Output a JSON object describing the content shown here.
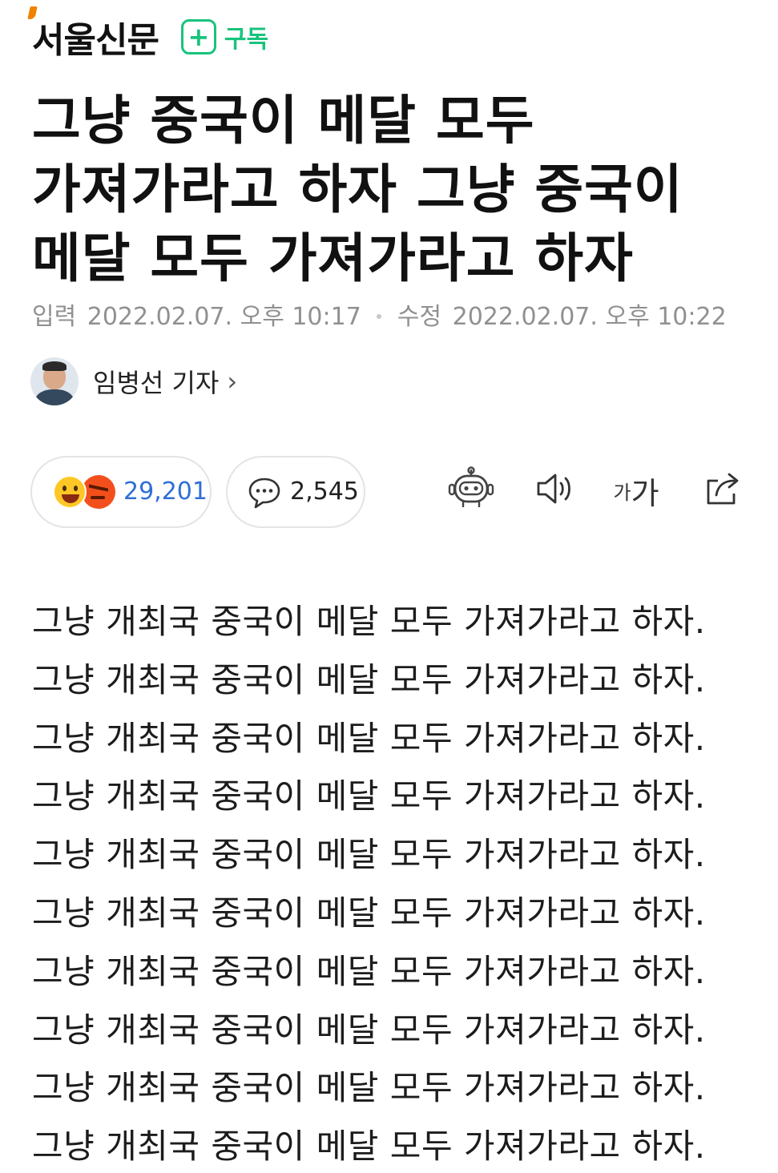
{
  "press": {
    "name": "서울신문",
    "subscribe_label": "구독",
    "brand_color": "#19c37d",
    "logo_accent_color": "#f08200"
  },
  "article": {
    "title": "그냥 중국이 메달 모두 가져가라고 하자 그냥 중국이 메달 모두 가져가라고 하자",
    "input_label": "입력",
    "input_time": "2022.02.07. 오후 10:17",
    "modified_label": "수정",
    "modified_time": "2022.02.07. 오후 10:22",
    "reporter": "임병선 기자",
    "reporter_chevron": "›",
    "reactions": {
      "count": "29,201",
      "icons": [
        "smile-emoji-icon",
        "angry-emoji-icon"
      ]
    },
    "comments": {
      "count": "2,545",
      "icon": "comment-bubble-icon"
    },
    "tools": {
      "bot_icon": "summary-bot-icon",
      "speaker_icon": "speaker-icon",
      "font_small": "가",
      "font_big": "가",
      "share_icon": "share-icon"
    },
    "body_lines": [
      "그냥 개최국 중국이 메달 모두 가져가라고 하자.",
      "그냥 개최국 중국이 메달 모두 가져가라고 하자.",
      "그냥 개최국 중국이 메달 모두 가져가라고 하자.",
      "그냥 개최국 중국이 메달 모두 가져가라고 하자.",
      "그냥 개최국 중국이 메달 모두 가져가라고 하자.",
      "그냥 개최국 중국이 메달 모두 가져가라고 하자.",
      "그냥 개최국 중국이 메달 모두 가져가라고 하자.",
      "그냥 개최국 중국이 메달 모두 가져가라고 하자.",
      "그냥 개최국 중국이 메달 모두 가져가라고 하자.",
      "그냥 개최국 중국이 메달 모두 가져가라고 하자."
    ]
  }
}
